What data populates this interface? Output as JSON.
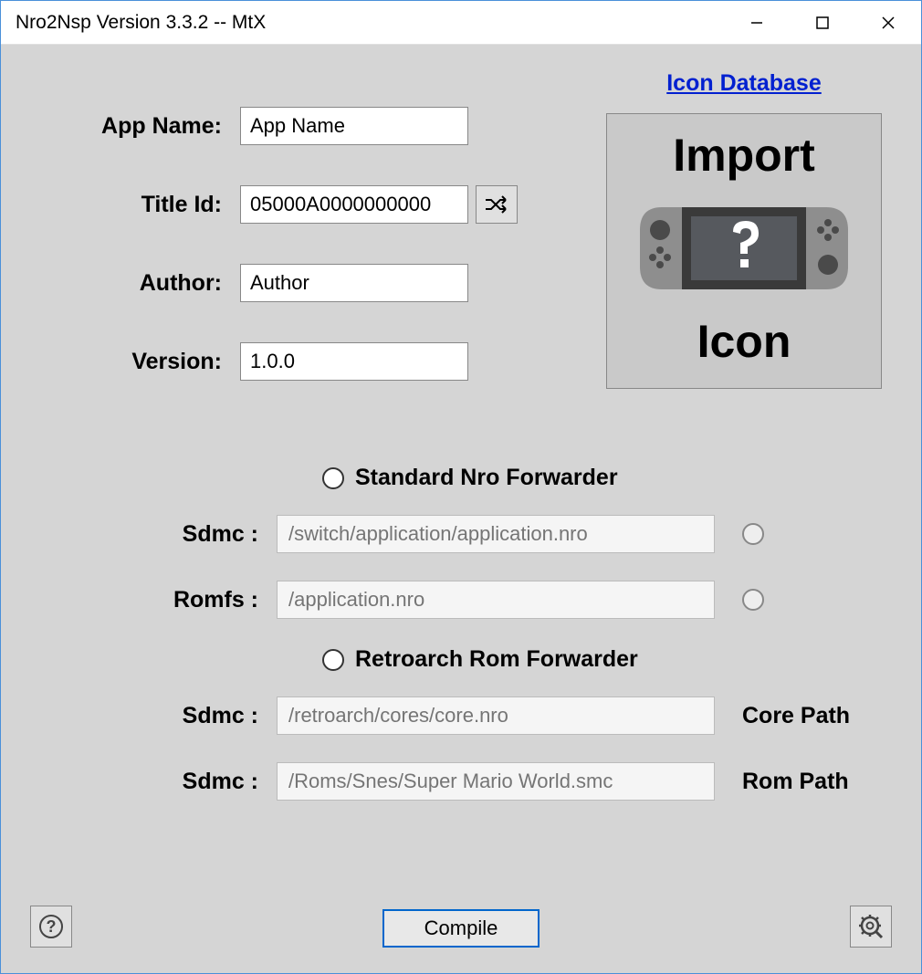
{
  "window": {
    "title": "Nro2Nsp Version 3.3.2 -- MtX"
  },
  "fields": {
    "appName": {
      "label": "App Name:",
      "value": "App Name"
    },
    "titleId": {
      "label": "Title Id:",
      "value": "05000A0000000000"
    },
    "author": {
      "label": "Author:",
      "value": "Author"
    },
    "version": {
      "label": "Version:",
      "value": "1.0.0"
    }
  },
  "iconDatabaseLink": "Icon Database",
  "iconBox": {
    "top": "Import",
    "bottom": "Icon"
  },
  "forwarders": {
    "standard": {
      "radioLabel": "Standard Nro Forwarder",
      "sdmc": {
        "label": "Sdmc :",
        "placeholder": "/switch/application/application.nro"
      },
      "romfs": {
        "label": "Romfs :",
        "placeholder": "/application.nro"
      }
    },
    "retroarch": {
      "radioLabel": "Retroarch Rom Forwarder",
      "core": {
        "label": "Sdmc :",
        "placeholder": "/retroarch/cores/core.nro",
        "trail": "Core Path"
      },
      "rom": {
        "label": "Sdmc :",
        "placeholder": "/Roms/Snes/Super Mario World.smc",
        "trail": "Rom Path"
      }
    }
  },
  "buttons": {
    "compile": "Compile"
  }
}
